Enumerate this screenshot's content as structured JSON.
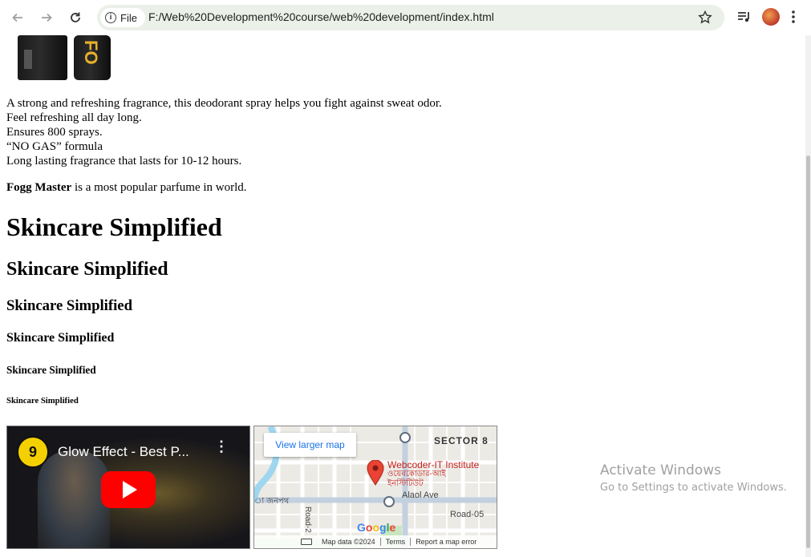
{
  "browser": {
    "file_chip": "File",
    "url": "F:/Web%20Development%20course/web%20development/index.html"
  },
  "product": {
    "description_lines": [
      "A strong and refreshing fragrance, this deodorant spray helps you fight against sweat odor.",
      "Feel refreshing all day long.",
      "Ensures 800 sprays.",
      "“NO GAS” formula",
      "Long lasting fragrance that lasts for 10-12 hours."
    ],
    "brand_bold": "Fogg Master",
    "brand_rest": " is a most popular parfume in world."
  },
  "headings": {
    "h1": "Skincare Simplified",
    "h2": "Skincare Simplified",
    "h3": "Skincare Simplified",
    "h4": "Skincare Simplified",
    "h5": "Skincare Simplified",
    "h6": "Skincare Simplified"
  },
  "video": {
    "title": "Glow Effect - Best P...",
    "channel_glyph": "9",
    "more_glyph": "⋮"
  },
  "map": {
    "view_larger": "View larger map",
    "sector": "SECTOR 8",
    "place_name": "Webcoder-IT Institute",
    "place_sub_line1": "ওয়েবকোডার-আই",
    "place_sub_line2": "ইনস্টিটিউট",
    "street_1": "Alaol Ave",
    "street_2": "Road-05",
    "street_3": "Road-2",
    "street_4": "া জনপথ",
    "google": [
      "G",
      "o",
      "o",
      "g",
      "l",
      "e"
    ],
    "map_data": "Map data ©2024",
    "terms": "Terms",
    "report": "Report a map error"
  },
  "watermark": {
    "line1": "Activate Windows",
    "line2": "Go to Settings to activate Windows."
  },
  "colors": {
    "omnibox_bg": "#ebf0e8",
    "youtube_red": "#ff0000",
    "map_link": "#1a73e8",
    "place_red": "#c5221f"
  }
}
